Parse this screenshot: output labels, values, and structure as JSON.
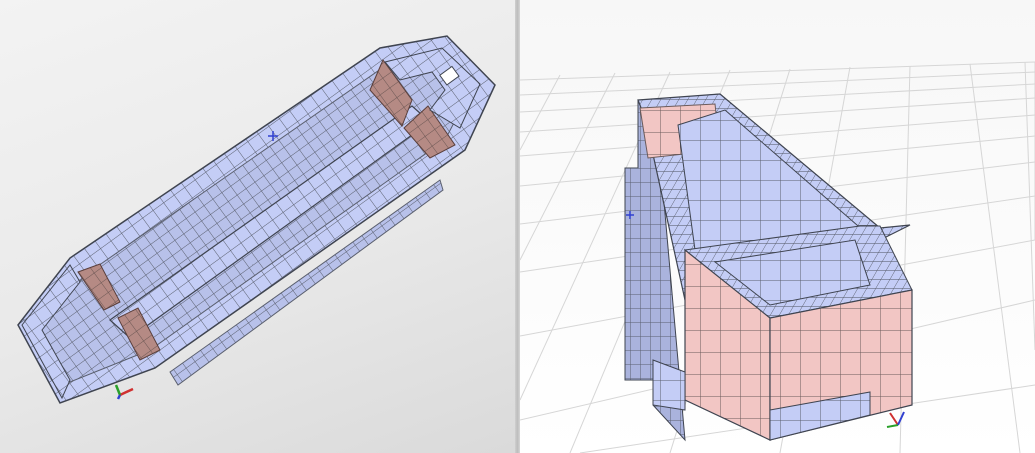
{
  "viewports": [
    {
      "id": "left",
      "view": "top oblique",
      "grid": false
    },
    {
      "id": "right",
      "view": "perspective",
      "grid": true
    }
  ],
  "colors": {
    "panel": "#c4cdf6",
    "panel_stroke": "#5a5f6e",
    "panel_dark": "#9aa1c2",
    "wall_pink": "#f2c6c4",
    "wall_brown": "#b58a84",
    "wall_pink_dark": "#d7a9a6",
    "grid_line": "#d6d6d6",
    "axis_x": "#d03030",
    "axis_y": "#2aa02a",
    "axis_z": "#3040d0"
  },
  "icons": [
    "axis-triad-icon",
    "origin-marker-icon"
  ]
}
